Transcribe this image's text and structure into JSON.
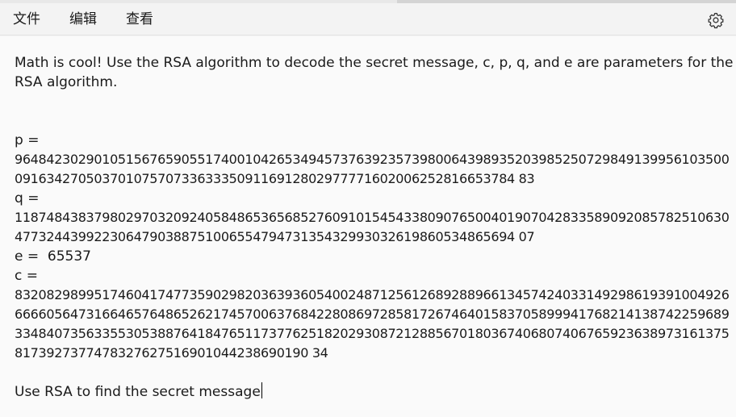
{
  "menu": {
    "file": "文件",
    "edit": "编辑",
    "view": "查看",
    "settings_icon": "gear-icon"
  },
  "document": {
    "intro": "Math is cool! Use the RSA algorithm to decode the secret message, c, p, q, and e are parameters for the RSA algorithm.",
    "p_label": "p =",
    "p_lines": [
      "964842302901051567659055174001042653494573763923573980064398935203985250729849139956103500",
      "091634270503701075707336333509116912802977771602006252816653784 83"
    ],
    "q_label": "q =",
    "q_lines": [
      "118748438379802970320924058486536568527609101545433809076500401907042833589092085782510630",
      "477324439922306479038875100655479473135432993032619860534865694 07"
    ],
    "e_line": "e =  65537",
    "c_label": "c =",
    "c_lines": [
      "832082989951746041747735902982036393605400248712561268928896613457424033149298619391004926",
      "666605647316646576486526217457006376842280869728581726746401583705899941768214138742259689",
      "334840735633553053887641847651173776251820293087212885670180367406807406765923638973161375",
      "8173927377478327627516901044238690190 34"
    ],
    "final": "Use RSA to find the secret message"
  }
}
